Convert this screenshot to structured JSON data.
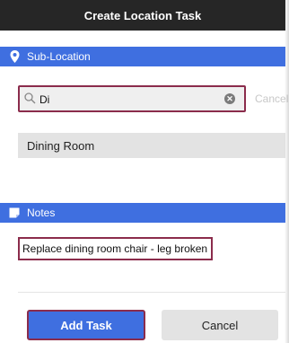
{
  "window": {
    "title": "Create Location Task"
  },
  "sublocation": {
    "header": "Sub-Location",
    "icon": "location-pin-icon",
    "search": {
      "value": "Di",
      "clear_icon": "clear-icon",
      "cancel_label": "Cancel"
    },
    "results": [
      "Dining Room"
    ]
  },
  "notes": {
    "header": "Notes",
    "icon": "note-icon",
    "text": "Replace dining room chair - leg broken"
  },
  "actions": {
    "add_label": "Add Task",
    "cancel_label": "Cancel"
  },
  "colors": {
    "title_bar": "#262626",
    "accent": "#3f6fe0",
    "highlight_border": "#8b2c4c",
    "row_gray": "#e3e3e3"
  }
}
